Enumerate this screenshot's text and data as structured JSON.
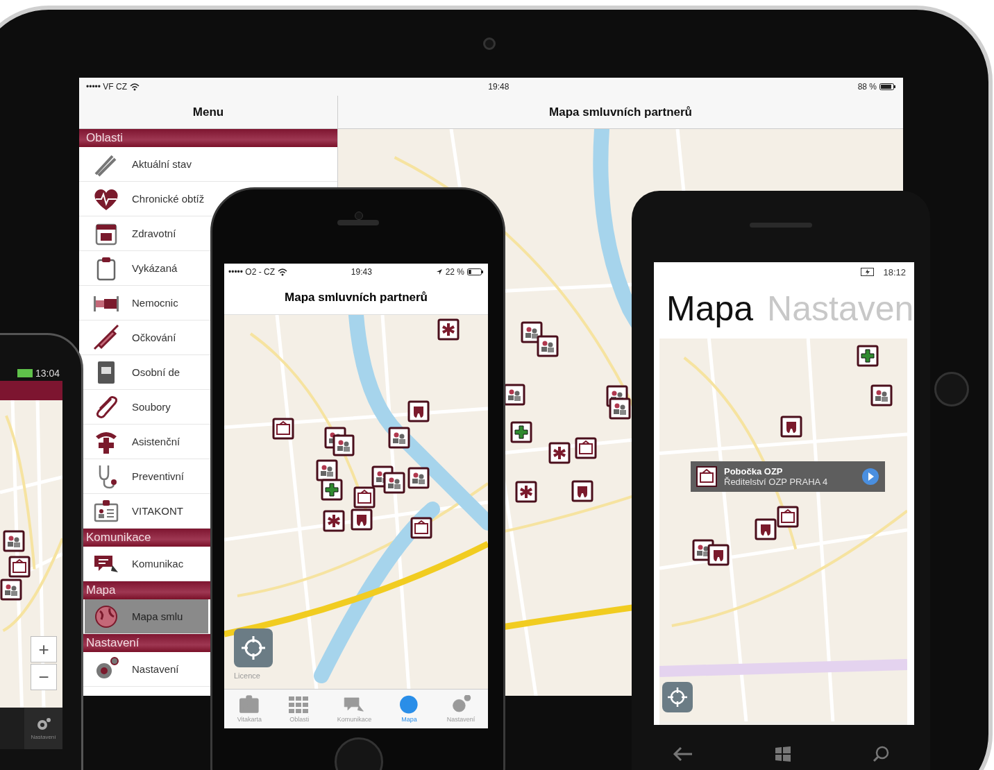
{
  "tablet": {
    "status_bar": {
      "carrier": "••••• VF CZ",
      "time": "19:48",
      "battery": "88 %"
    },
    "menu": {
      "title": "Menu",
      "sections": [
        {
          "title": "Oblasti",
          "items": [
            {
              "label": "Aktuální stav",
              "selected": false
            },
            {
              "label": "Chronické obtíž",
              "selected": false
            },
            {
              "label": "Zdravotní",
              "selected": false
            },
            {
              "label": "Vykázaná",
              "selected": false
            },
            {
              "label": "Nemocnic",
              "selected": false
            },
            {
              "label": "Očkování",
              "selected": false
            },
            {
              "label": "Osobní de",
              "selected": false
            },
            {
              "label": "Soubory",
              "selected": false
            },
            {
              "label": "Asistenční",
              "selected": false
            },
            {
              "label": "Preventivní",
              "selected": false
            },
            {
              "label": "VITAKONT",
              "selected": false
            }
          ]
        },
        {
          "title": "Komunikace",
          "items": [
            {
              "label": "Komunikac",
              "selected": false
            }
          ]
        },
        {
          "title": "Mapa",
          "items": [
            {
              "label": "Mapa smlu",
              "selected": true
            }
          ]
        },
        {
          "title": "Nastavení",
          "items": [
            {
              "label": "Nastavení",
              "selected": false
            }
          ]
        }
      ]
    },
    "map_view": {
      "title": "Mapa smluvních partnerů"
    }
  },
  "android_phone": {
    "status_bar": {
      "time": "13:04"
    },
    "zoom_buttons": [
      "+",
      "−"
    ],
    "tab_bar": [
      {
        "label": "Nastavení",
        "selected": false
      }
    ]
  },
  "iphone": {
    "status_bar": {
      "carrier": "••••• O2 - CZ",
      "time": "19:43",
      "battery": "22 %"
    },
    "title": "Mapa smluvních partnerů",
    "map": {
      "license": "Licence"
    },
    "tab_bar": [
      {
        "label": "Vitakarta",
        "selected": false
      },
      {
        "label": "Oblasti",
        "selected": false
      },
      {
        "label": "Komunikace",
        "selected": false
      },
      {
        "label": "Mapa",
        "selected": true
      },
      {
        "label": "Nastavení",
        "selected": false
      }
    ]
  },
  "windows_phone": {
    "status_bar": {
      "time": "18:12"
    },
    "pivot": [
      {
        "label": "Mapa",
        "selected": true
      },
      {
        "label": "Nastaven",
        "selected": false
      }
    ],
    "callout": {
      "title": "Pobočka OZP",
      "subtitle": "Ředitelství OZP PRAHA 4"
    }
  }
}
